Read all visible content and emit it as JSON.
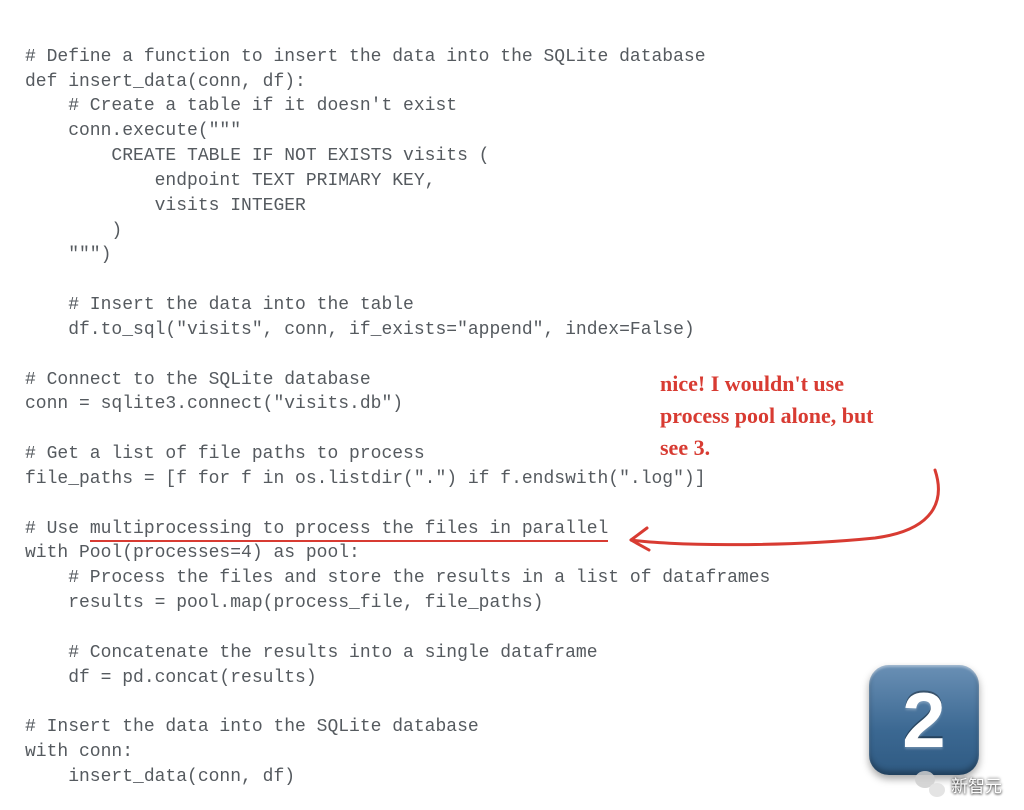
{
  "code": {
    "l1": "# Define a function to insert the data into the SQLite database",
    "l2": "def insert_data(conn, df):",
    "l3": "    # Create a table if it doesn't exist",
    "l4": "    conn.execute(\"\"\"",
    "l5": "        CREATE TABLE IF NOT EXISTS visits (",
    "l6": "            endpoint TEXT PRIMARY KEY,",
    "l7": "            visits INTEGER",
    "l8": "        )",
    "l9": "    \"\"\")",
    "l10": "",
    "l11": "    # Insert the data into the table",
    "l12": "    df.to_sql(\"visits\", conn, if_exists=\"append\", index=False)",
    "l13": "",
    "l14": "# Connect to the SQLite database",
    "l15": "conn = sqlite3.connect(\"visits.db\")",
    "l16": "",
    "l17": "# Get a list of file paths to process",
    "l18": "file_paths = [f for f in os.listdir(\".\") if f.endswith(\".log\")]",
    "l19": "",
    "l20_a": "# Use ",
    "l20_b": "multiprocessing to process the files in parallel",
    "l21": "with Pool(processes=4) as pool:",
    "l22": "    # Process the files and store the results in a list of dataframes",
    "l23": "    results = pool.map(process_file, file_paths)",
    "l24": "",
    "l25": "    # Concatenate the results into a single dataframe",
    "l26": "    df = pd.concat(results)",
    "l27": "",
    "l28": "# Insert the data into the SQLite database",
    "l29": "with conn:",
    "l30": "    insert_data(conn, df)"
  },
  "annotation": {
    "line1": "nice! I wouldn't use",
    "line2": "process pool alone, but",
    "line3": "see 3."
  },
  "badge": {
    "number": "2"
  },
  "watermark": {
    "text": "新智元"
  }
}
